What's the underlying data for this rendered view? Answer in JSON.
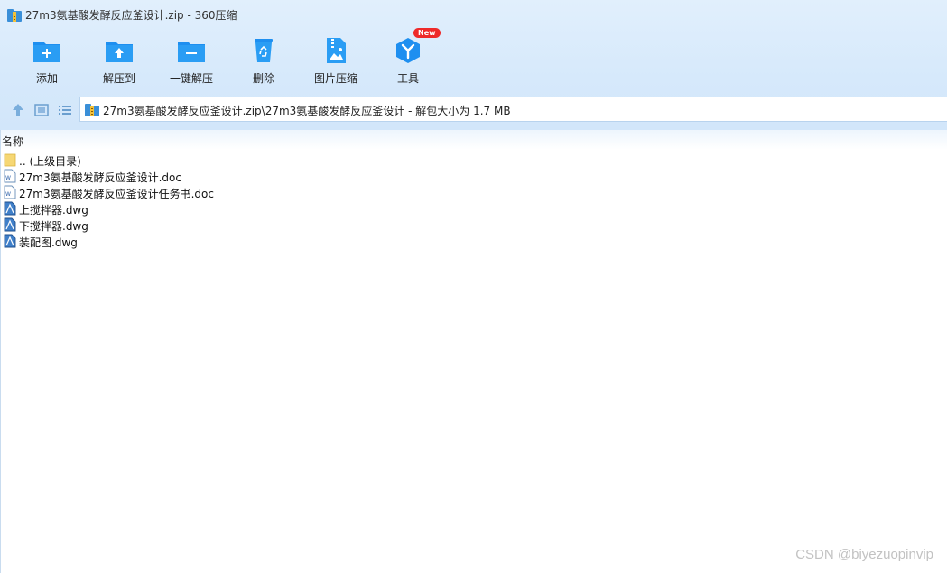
{
  "window": {
    "title": "27m3氨基酸发酵反应釜设计.zip - 360压缩",
    "app_icon": "zip-archive-icon"
  },
  "toolbar": {
    "items": [
      {
        "label": "添加",
        "icon": "add-folder-icon"
      },
      {
        "label": "解压到",
        "icon": "extract-to-folder-icon"
      },
      {
        "label": "一键解压",
        "icon": "one-click-extract-icon"
      },
      {
        "label": "删除",
        "icon": "recycle-bin-icon"
      },
      {
        "label": "图片压缩",
        "icon": "image-compress-icon"
      },
      {
        "label": "工具",
        "icon": "tools-cube-icon",
        "badge": "New"
      }
    ]
  },
  "address": {
    "path": "27m3氨基酸发酵反应釜设计.zip\\27m3氨基酸发酵反应釜设计 - 解包大小为 1.7 MB"
  },
  "filelist": {
    "column_name": "名称",
    "rows": [
      {
        "name": ".. (上级目录)",
        "icon": "folder-icon"
      },
      {
        "name": "27m3氨基酸发酵反应釜设计.doc",
        "icon": "word-doc-icon"
      },
      {
        "name": "27m3氨基酸发酵反应釜设计任务书.doc",
        "icon": "word-doc-icon"
      },
      {
        "name": "上搅拌器.dwg",
        "icon": "dwg-file-icon"
      },
      {
        "name": "下搅拌器.dwg",
        "icon": "dwg-file-icon"
      },
      {
        "name": "装配图.dwg",
        "icon": "dwg-file-icon"
      }
    ]
  },
  "watermark": "CSDN @biyezuopinvip",
  "colors": {
    "accent": "#1e8ff0",
    "header_bg": "#d6e9fb",
    "badge": "#ee2a2a"
  }
}
